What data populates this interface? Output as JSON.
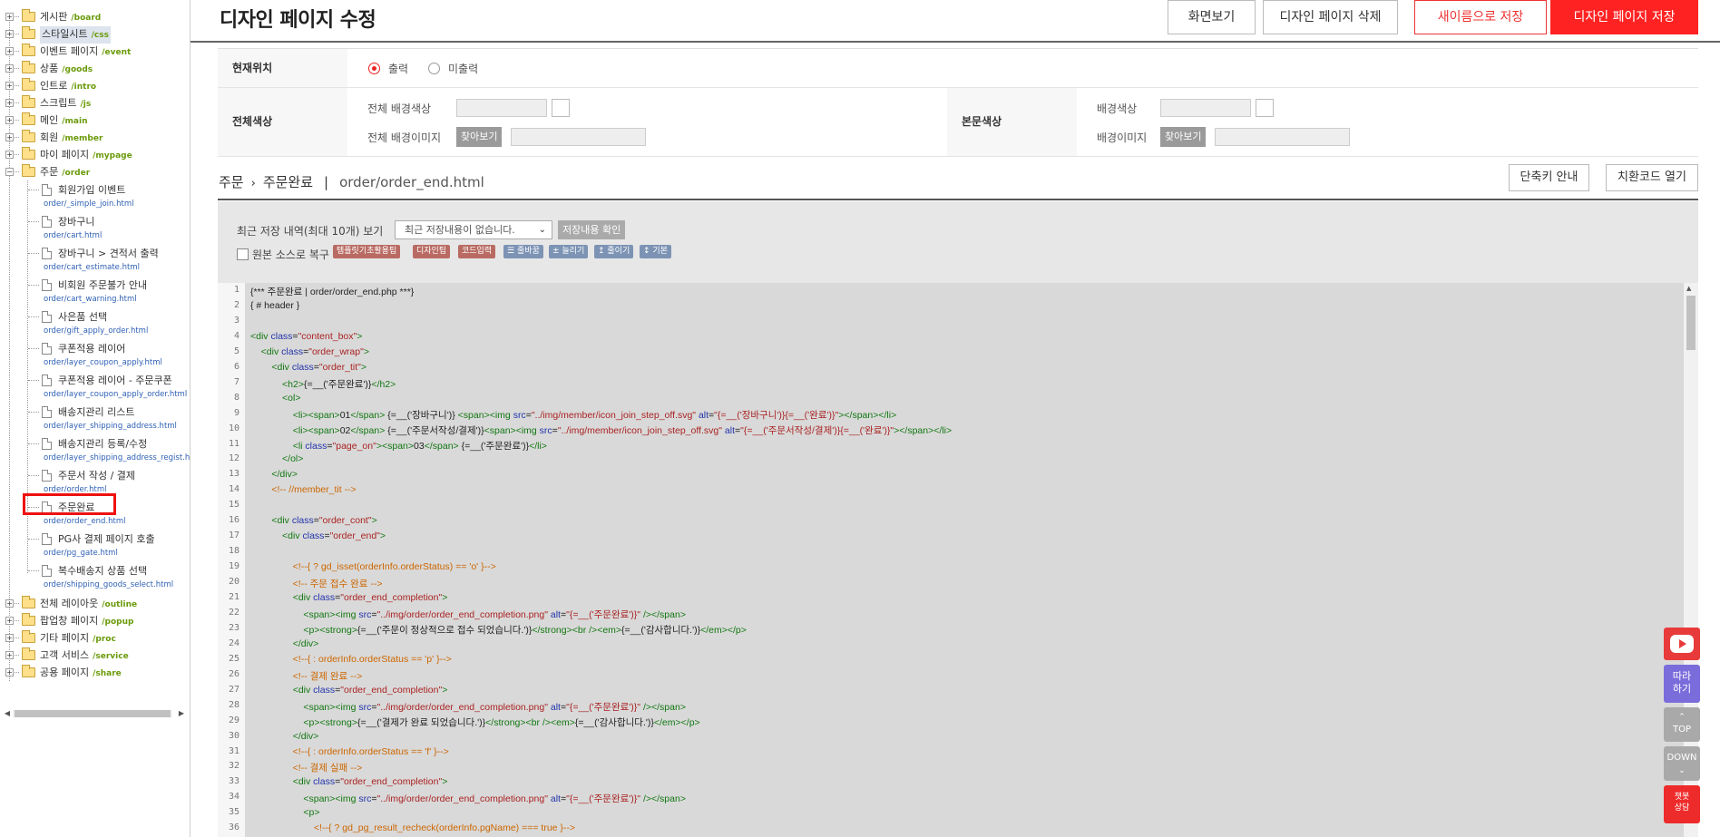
{
  "header": {
    "title": "디자인 페이지 수정",
    "buttons": {
      "preview": "화면보기",
      "delete": "디자인 페이지 삭제",
      "save_as": "새이름으로 저장",
      "save": "디자인 페이지 저장"
    }
  },
  "sidebar": {
    "top_folders": [
      {
        "name": "게시판",
        "path": "/board"
      },
      {
        "name": "스타일시트",
        "path": "/css"
      },
      {
        "name": "이벤트 페이지",
        "path": "/event"
      },
      {
        "name": "상품",
        "path": "/goods"
      },
      {
        "name": "인트로",
        "path": "/intro"
      },
      {
        "name": "스크립트",
        "path": "/js"
      },
      {
        "name": "메인",
        "path": "/main"
      },
      {
        "name": "회원",
        "path": "/member"
      },
      {
        "name": "마이 페이지",
        "path": "/mypage"
      },
      {
        "name": "주문",
        "path": "/order"
      }
    ],
    "order_files": [
      {
        "name": "회원가입 이벤트",
        "path": "order/_simple_join.html"
      },
      {
        "name": "장바구니",
        "path": "order/cart.html"
      },
      {
        "name": "장바구니 > 견적서 출력",
        "path": "order/cart_estimate.html"
      },
      {
        "name": "비회원 주문불가 안내",
        "path": "order/cart_warning.html"
      },
      {
        "name": "사은품 선택",
        "path": "order/gift_apply_order.html"
      },
      {
        "name": "쿠폰적용 레이어",
        "path": "order/layer_coupon_apply.html"
      },
      {
        "name": "쿠폰적용 레이어 - 주문쿠폰",
        "path": "order/layer_coupon_apply_order.html"
      },
      {
        "name": "배송지관리 리스트",
        "path": "order/layer_shipping_address.html"
      },
      {
        "name": "배송지관리 등록/수정",
        "path": "order/layer_shipping_address_regist.html"
      },
      {
        "name": "주문서 작성 / 결제",
        "path": "order/order.html"
      },
      {
        "name": "주문완료",
        "path": "order/order_end.html"
      },
      {
        "name": "PG사 결제 페이지 호출",
        "path": "order/pg_gate.html"
      },
      {
        "name": "복수배송지 상품 선택",
        "path": "order/shipping_goods_select.html"
      }
    ],
    "bottom_folders": [
      {
        "name": "전체 레이아웃",
        "path": "/outline"
      },
      {
        "name": "팝업창 페이지",
        "path": "/popup"
      },
      {
        "name": "기타 페이지",
        "path": "/proc"
      },
      {
        "name": "고객 서비스",
        "path": "/service"
      },
      {
        "name": "공용 페이지",
        "path": "/share"
      }
    ]
  },
  "settings": {
    "current_position": {
      "label": "현재위치",
      "options": [
        "출력",
        "미출력"
      ],
      "selected": "출력"
    },
    "total_color": {
      "label": "전체색상",
      "bg_color_label": "전체 배경색상",
      "bg_image_label": "전체 배경이미지",
      "find_button": "찾아보기"
    },
    "body_color": {
      "label": "본문색상",
      "bg_color_label": "배경색상",
      "bg_image_label": "배경이미지",
      "find_button": "찾아보기"
    }
  },
  "breadcrumb": {
    "section": "주문",
    "page": "주문완료",
    "file": "order/order_end.html",
    "buttons": {
      "shortcut": "단축키 안내",
      "replace_code": "치환코드 열기"
    }
  },
  "editor": {
    "history_label": "최근 저장 내역(최대 10개) 보기",
    "history_select": "최근 저장내용이 없습니다.",
    "history_button": "저장내용 확인",
    "restore_label": "원본 소스로 복구",
    "tags": [
      "템플릿기초활용팁",
      "디자인팁",
      "코드입력",
      "줄바꿈",
      "늘리기",
      "줄이기",
      "기본"
    ],
    "tag_colors": {
      "brown": "#b96b63",
      "blue": "#7c93b4"
    }
  },
  "code_lines": [
    "{*** 주문완료 | order/order_end.php ***}",
    "{ # header }",
    "",
    "<div class=\"content_box\">",
    "    <div class=\"order_wrap\">",
    "        <div class=\"order_tit\">",
    "            <h2>{=__('주문완료')}</h2>",
    "            <ol>",
    "                <li><span>01</span> {=__('장바구니')} <span><img src=\"../img/member/icon_join_step_off.svg\" alt=\"{=__('장바구니')}{=__('완료')}\"></span></li>",
    "                <li><span>02</span> {=__('주문서작성/결제')}<span><img src=\"../img/member/icon_join_step_off.svg\" alt=\"{=__('주문서작성/결제')}{=__('완료')}\"></span></li>",
    "                <li class=\"page_on\"><span>03</span> {=__('주문완료')}</li>",
    "            </ol>",
    "        </div>",
    "        <!-- //member_tit -->",
    "",
    "        <div class=\"order_cont\">",
    "            <div class=\"order_end\">",
    "",
    "                <!--{ ? gd_isset(orderInfo.orderStatus) == 'o' }-->",
    "                <!-- 주문 접수 완료 -->",
    "                <div class=\"order_end_completion\">",
    "                    <span><img src=\"../img/order/order_end_completion.png\" alt=\"{=__('주문완료')}\" /></span>",
    "                    <p><strong>{=__('주문이 정상적으로 접수 되었습니다.')}</strong><br /><em>{=__('감사합니다.')}</em></p>",
    "                </div>",
    "                <!--{ : orderInfo.orderStatus == 'p' }-->",
    "                <!-- 결제 완료 -->",
    "                <div class=\"order_end_completion\">",
    "                    <span><img src=\"../img/order/order_end_completion.png\" alt=\"{=__('주문완료')}\" /></span>",
    "                    <p><strong>{=__('결제가 완료 되었습니다.')}</strong><br /><em>{=__('감사합니다.')}</em></p>",
    "                </div>",
    "                <!--{ : orderInfo.orderStatus == 'f' }-->",
    "                <!-- 결제 실패 -->",
    "                <div class=\"order_end_completion\">",
    "                    <span><img src=\"../img/order/order_end_completion.png\" alt=\"{=__('주문완료')}\" /></span>",
    "                    <p>",
    "                        <!--{ ? gd_pg_result_recheck(orderInfo.pgName) === true }-->"
  ],
  "floating": {
    "follow": "따라\n하기",
    "top": "TOP",
    "down": "DOWN",
    "chat": "챗봇\n상담"
  },
  "colors": {
    "accent_red": "#ff2222",
    "green_path": "#6a9a0a",
    "blue_path": "#2d5fb4",
    "follow_purple": "#7b6cdb",
    "gray_float": "#a9a9a9"
  }
}
